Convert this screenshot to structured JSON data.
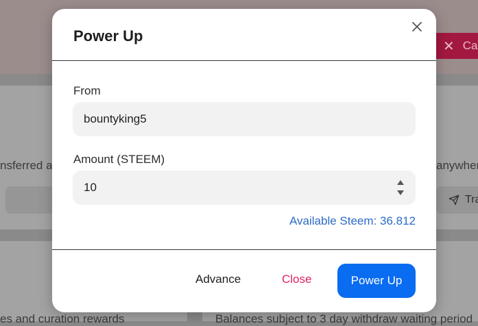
{
  "background": {
    "cancel_label": "Car",
    "text_left": "nsferred a",
    "text_right": "anywhere",
    "transfer_label": "Tra",
    "bottom_left_text": "es and curation rewards",
    "bottom_right_text": "Balances subject to 3 day withdraw waiting period"
  },
  "modal": {
    "title": "Power Up",
    "from_label": "From",
    "from_value": "bountyking5",
    "amount_label": "Amount (STEEM)",
    "amount_value": "10",
    "available_text": "Available Steem: 36.812",
    "advance_label": "Advance",
    "close_label": "Close",
    "power_up_label": "Power Up"
  },
  "colors": {
    "primary_button": "#0a6cf0",
    "close_text": "#e0245e",
    "available_text": "#2d6bc5"
  }
}
